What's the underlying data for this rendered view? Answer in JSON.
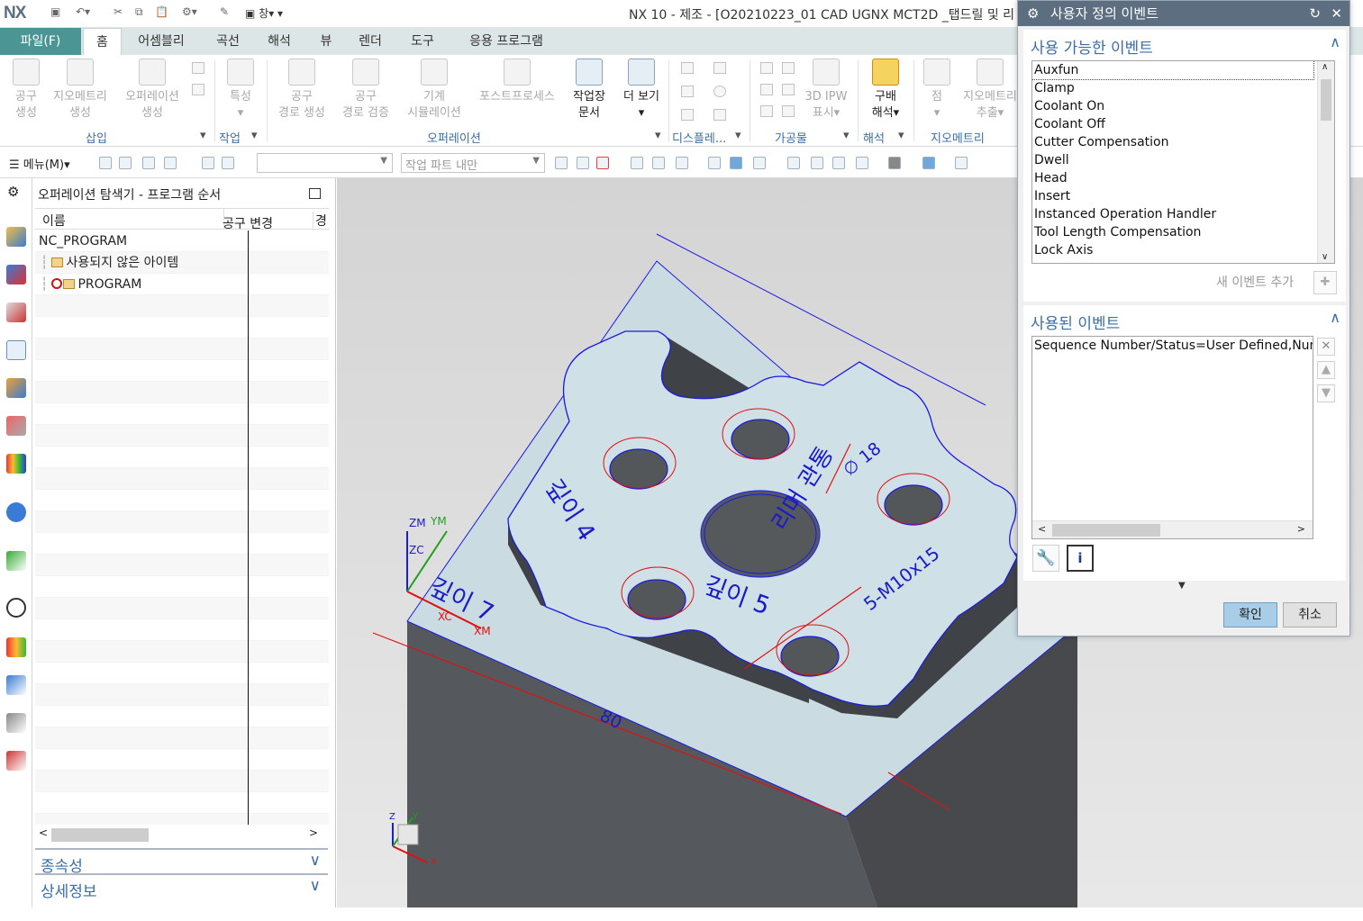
{
  "titlebar": {
    "logo": "NX",
    "window_menu": "창",
    "title": "NX 10 - 제조 - [O20210223_01 CAD UGNX MCT2D _탭드릴 및 리"
  },
  "tabs": {
    "file": "파일(F)",
    "items": [
      "홈",
      "어셈블리",
      "곡선",
      "해석",
      "뷰",
      "렌더",
      "도구",
      "응용 프로그램"
    ],
    "active": "홈"
  },
  "ribbon": {
    "buttons": [
      {
        "label1": "공구",
        "label2": "생성"
      },
      {
        "label1": "지오메트리",
        "label2": "생성"
      },
      {
        "label1": "오퍼레이션",
        "label2": "생성"
      },
      {
        "label1": "특성",
        "label2": "▾"
      },
      {
        "label1": "공구",
        "label2": "경로 생성"
      },
      {
        "label1": "공구",
        "label2": "경로 검증"
      },
      {
        "label1": "기계",
        "label2": "시뮬레이션"
      },
      {
        "label1": "포스트프로세스",
        "label2": ""
      },
      {
        "label1": "작업장",
        "label2": "문서"
      },
      {
        "label1": "더 보기",
        "label2": "▾"
      },
      {
        "label1": "3D IPW",
        "label2": "표시▾"
      },
      {
        "label1": "구배",
        "label2": "해석▾"
      },
      {
        "label1": "점",
        "label2": "▾"
      },
      {
        "label1": "지오메트리",
        "label2": "추출▾"
      }
    ],
    "groups": [
      "삽입",
      "작업",
      "오퍼레이션",
      "디스플레...",
      "가공물",
      "해석",
      "지오메트리"
    ]
  },
  "toolbar": {
    "menu_label": "메뉴(M)▾",
    "filter_value": "",
    "scope_value": "작업 파트 내만"
  },
  "navigator": {
    "title": "오퍼레이션 탐색기 - 프로그램 순서",
    "columns": [
      "이름",
      "공구 변경",
      "경"
    ],
    "rows": [
      {
        "name": "NC_PROGRAM",
        "indent": 0
      },
      {
        "name": "사용되지 않은 아이템",
        "indent": 1
      },
      {
        "name": "PROGRAM",
        "indent": 1
      }
    ],
    "sections": [
      "종속성",
      "상세정보"
    ]
  },
  "viewport": {
    "annotations": {
      "depth4": "깊이 4",
      "depth7": "깊이 7",
      "depth5": "깊이 5",
      "reamer": "리머 관통",
      "tap": "5-M10x15",
      "dia": "∅ 18",
      "dim80": "80",
      "zm": "ZM",
      "ym": "YM",
      "zc": "ZC",
      "xc": "XC",
      "xm": "XM",
      "tz": "Z",
      "ty": "Y",
      "tx": "X"
    },
    "colors": {
      "face": "#c9dde4",
      "wall": "#5a5e62",
      "annotation": "#1a1ac8",
      "dimension": "#e01010"
    }
  },
  "dialog": {
    "title": "사용자 정의 이벤트",
    "available": {
      "header": "사용 가능한 이벤트",
      "items": [
        "Auxfun",
        "Clamp",
        "Coolant On",
        "Coolant Off",
        "Cutter Compensation",
        "Dwell",
        "Head",
        "Insert",
        "Instanced Operation Handler",
        "Tool Length Compensation",
        "Lock Axis"
      ],
      "selected": "Auxfun",
      "add_label": "새 이벤트 추가"
    },
    "used": {
      "header": "사용된 이벤트",
      "items": [
        "Sequence Number/Status=User Defined,Num"
      ]
    },
    "ok": "확인",
    "cancel": "취소"
  }
}
